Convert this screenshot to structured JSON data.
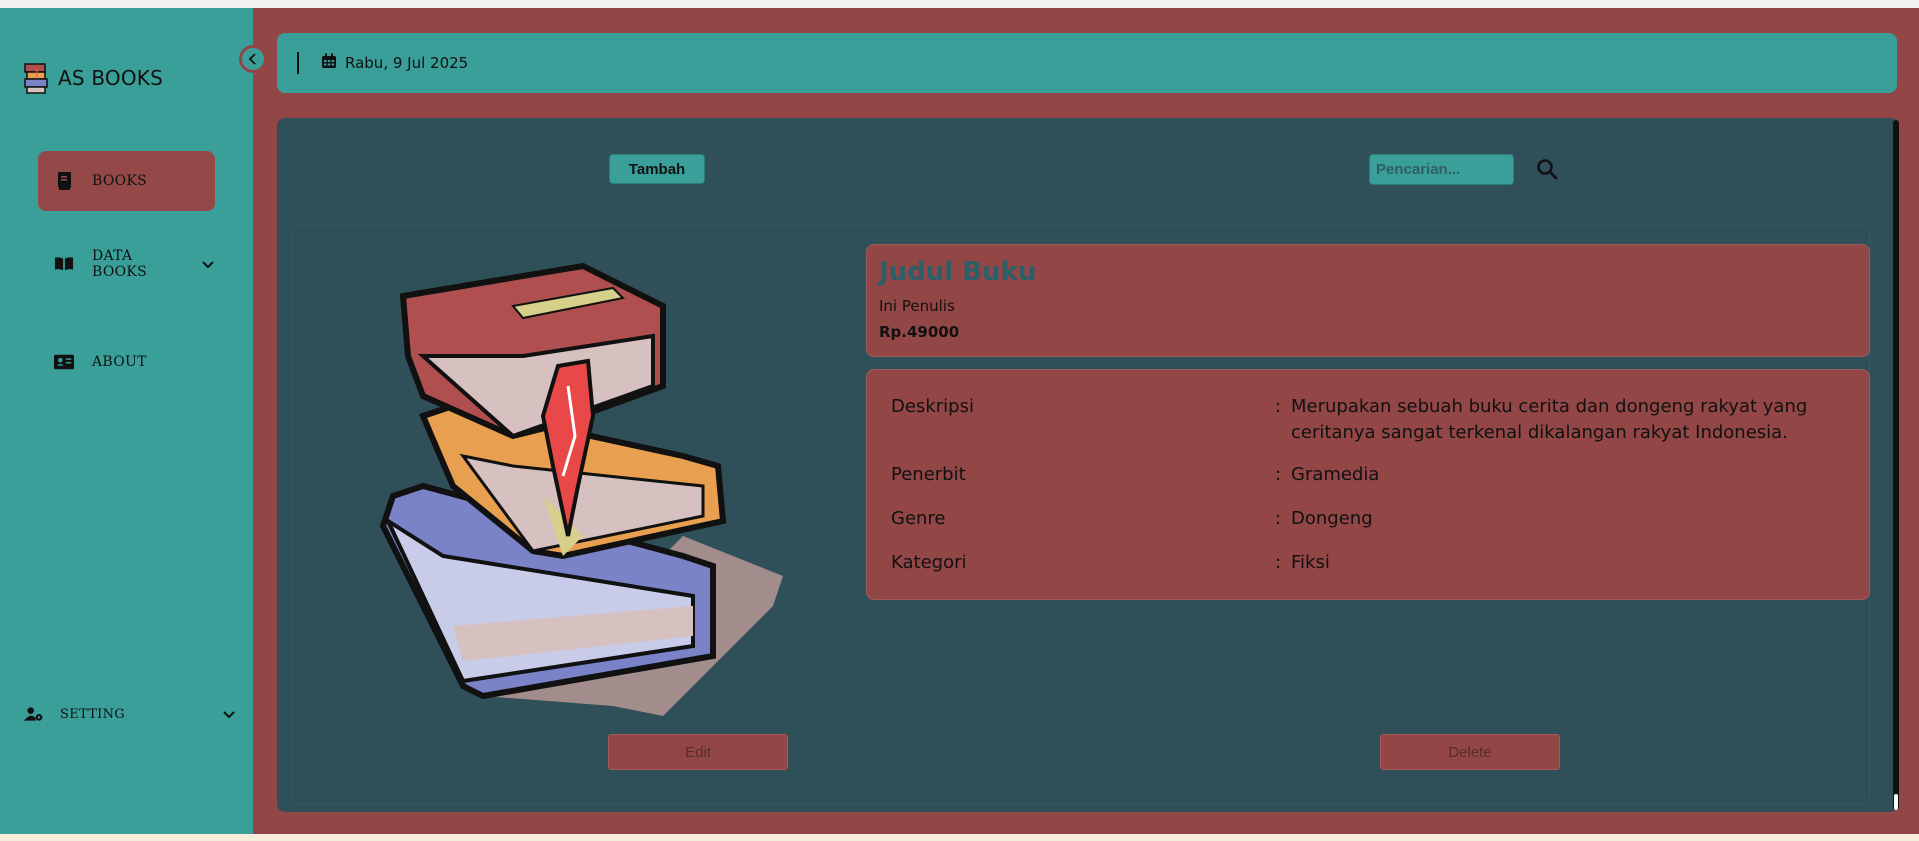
{
  "brand": {
    "name": "AS BOOKS"
  },
  "sidebar": {
    "items": [
      {
        "label": "BOOKS",
        "icon": "book-icon"
      },
      {
        "label": "DATA BOOKS",
        "icon": "open-book-icon"
      },
      {
        "label": "ABOUT",
        "icon": "id-card-icon"
      }
    ],
    "setting": {
      "label": "SETTING",
      "icon": "user-gear-icon"
    }
  },
  "topbar": {
    "date": "Rabu, 9 Jul 2025"
  },
  "toolbar": {
    "add_label": "Tambah",
    "search_placeholder": "Pencarian..."
  },
  "book": {
    "title": "Judul Buku",
    "author": "Ini Penulis",
    "price": "Rp.49000",
    "details": [
      {
        "label": "Deskripsi",
        "value": "Merupakan sebuah buku cerita dan dongeng rakyat yang ceritanya sangat terkenal dikalangan rakyat Indonesia."
      },
      {
        "label": "Penerbit",
        "value": "Gramedia"
      },
      {
        "label": "Genre",
        "value": "Dongeng"
      },
      {
        "label": "Kategori",
        "value": "Fiksi"
      }
    ],
    "separator": ":"
  },
  "actions": {
    "edit_label": "Edit",
    "delete_label": "Delete"
  },
  "colors": {
    "sidebar": "#3a9f98",
    "accent": "#924646",
    "panel": "#2f4f59"
  }
}
